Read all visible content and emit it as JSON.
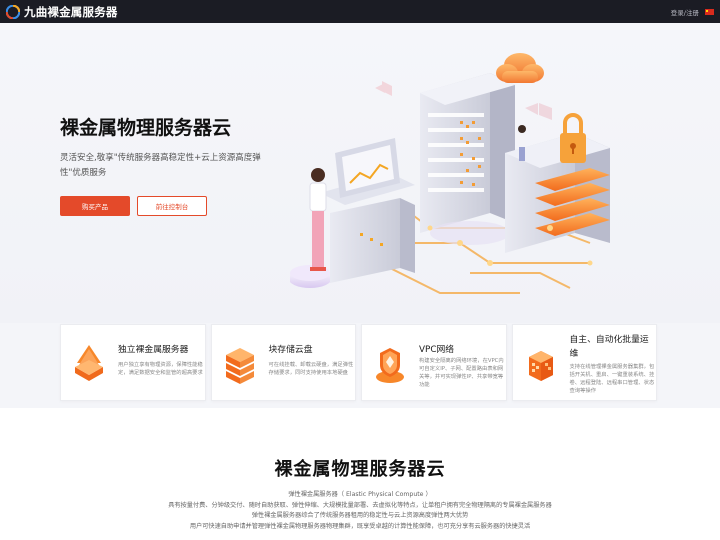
{
  "nav": {
    "brand": "九曲裸金属服务器",
    "login": "登录/注册"
  },
  "hero": {
    "title": "裸金属物理服务器云",
    "description": "灵活安全,敬享\"传统服务器高稳定性+云上资源高度弹性\"优质服务",
    "buy_label": "购买产品",
    "console_label": "前往控制台"
  },
  "features": [
    {
      "title": "独立裸金属服务器",
      "text": "用户独立享有物理资源，保障性能稳定，满足数据安全和监管的超高要求"
    },
    {
      "title": "块存储云盘",
      "text": "可在线挂载、卸载云硬盘，满足弹性存储要求，同时支持使用本地硬盘"
    },
    {
      "title": "VPC网络",
      "text": "构建安全隔离的网络环境，在VPC内可自定义IP、子网、配置路由表和网关等，并可实现弹性IP、共享带宽等功能"
    },
    {
      "title": "自主、自动化批量运维",
      "text": "支持在线管理裸金属服务器集群，包括开关机、重启、一键重装系统、挂卷、远程登陆、远程串口管理、状态查询等操作"
    }
  ],
  "intro": {
    "title": "裸金属物理服务器云",
    "lines": [
      "弹性裸金属服务器（ Elastic Physical Compute ）",
      "具有按量付费、分钟级交付、随时自助获取、弹性伸缩、大规模批量部署、去虚拟化等特点，让单租户拥有完全物理隔离的专属裸金属服务器",
      "弹性裸金属服务器综合了传统服务器租用的稳定性与云上资源高度弹性两大优势",
      "用户可快速自助申请并管理弹性裸金属物理服务器物理集群，既享受卓越的计算性能保障，也可充分享有云服务器的快捷灵活"
    ]
  },
  "colors": {
    "accent": "#e44a2a",
    "nav_bg": "#1b1c24",
    "icon_orange": "#f7872a"
  }
}
